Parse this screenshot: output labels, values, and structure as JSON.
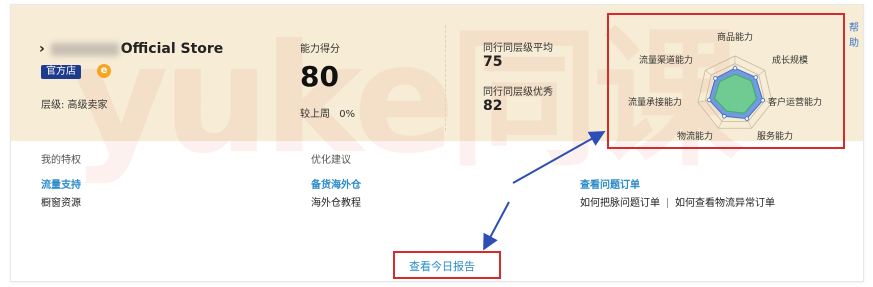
{
  "store": {
    "name": "Official Store",
    "badge": "官方店",
    "badge_icon": "e",
    "level": "层级: 高级卖家"
  },
  "score": {
    "label": "能力得分",
    "value": "80",
    "change_label": "较上周",
    "change_value": "0%"
  },
  "peers": {
    "avg_label": "同行同层级平均",
    "avg_value": "75",
    "excellent_label": "同行同层级优秀",
    "excellent_value": "82"
  },
  "help": "帮助",
  "radar": {
    "axes": [
      "商品能力",
      "成长规模",
      "客户运营能力",
      "服务能力",
      "物流能力",
      "流量承接能力",
      "流量渠道能力"
    ],
    "series": [
      {
        "values": [
          0.68,
          0.7,
          0.75,
          0.72,
          0.65,
          0.7,
          0.66
        ]
      },
      {
        "values": [
          0.52,
          0.55,
          0.58,
          0.56,
          0.5,
          0.55,
          0.52
        ]
      }
    ],
    "colors": {
      "outer": "#5a8fe0",
      "inner": "#6fd08a",
      "grid": "#c9b8a0"
    }
  },
  "sections": {
    "privileges": {
      "title": "我的特权",
      "link": "流量支持",
      "text": "橱窗资源"
    },
    "suggestions": {
      "title": "优化建议",
      "link": "备货海外仓",
      "text": "海外仓教程"
    },
    "orders": {
      "link": "查看问题订单",
      "text1": "如何把脉问题订单",
      "text2": "如何查看物流异常订单"
    }
  },
  "report_link": "查看今日报告",
  "watermark": "yuke同课"
}
